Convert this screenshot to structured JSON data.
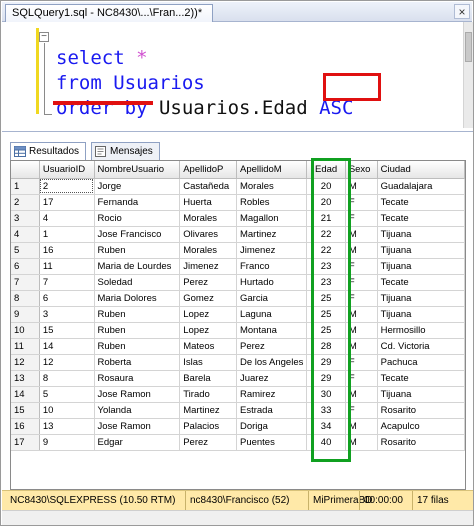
{
  "window": {
    "tab_title": "SQLQuery1.sql - NC8430\\...\\Fran...2))*",
    "close_glyph": "×"
  },
  "editor": {
    "line1": {
      "keyword": "select",
      "rest": " *"
    },
    "line2": {
      "keyword": "from",
      "rest": " Usuarios"
    },
    "line3": {
      "keyword": "order by",
      "rest": " Usuarios.Edad ",
      "highlight": "ASC"
    },
    "annotation_colors": {
      "underline": "#e01010",
      "asc_box": "#e01010",
      "edad_box": "#10a020"
    }
  },
  "results_tabs": [
    {
      "label": "Resultados",
      "icon": "grid-icon"
    },
    {
      "label": "Mensajes",
      "icon": "message-icon"
    }
  ],
  "grid": {
    "columns": [
      "",
      "UsuarioID",
      "NombreUsuario",
      "ApellidoP",
      "ApellidoM",
      "Edad",
      "Sexo",
      "Ciudad"
    ],
    "rows": [
      [
        "1",
        "2",
        "Jorge",
        "Castañeda",
        "Morales",
        "20",
        "M",
        "Guadalajara"
      ],
      [
        "2",
        "17",
        "Fernanda",
        "Huerta",
        "Robles",
        "20",
        "F",
        "Tecate"
      ],
      [
        "3",
        "4",
        "Rocio",
        "Morales",
        "Magallon",
        "21",
        "F",
        "Tecate"
      ],
      [
        "4",
        "1",
        "Jose Francisco",
        "Olivares",
        "Martinez",
        "22",
        "M",
        "Tijuana"
      ],
      [
        "5",
        "16",
        "Ruben",
        "Morales",
        "Jimenez",
        "22",
        "M",
        "Tijuana"
      ],
      [
        "6",
        "11",
        "Maria de Lourdes",
        "Jimenez",
        "Franco",
        "23",
        "F",
        "Tijuana"
      ],
      [
        "7",
        "7",
        "Soledad",
        "Perez",
        "Hurtado",
        "23",
        "F",
        "Tecate"
      ],
      [
        "8",
        "6",
        "Maria Dolores",
        "Gomez",
        "Garcia",
        "25",
        "F",
        "Tijuana"
      ],
      [
        "9",
        "3",
        "Ruben",
        "Lopez",
        "Laguna",
        "25",
        "M",
        "Tijuana"
      ],
      [
        "10",
        "15",
        "Ruben",
        "Lopez",
        "Montana",
        "25",
        "M",
        "Hermosillo"
      ],
      [
        "11",
        "14",
        "Ruben",
        "Mateos",
        "Perez",
        "28",
        "M",
        "Cd. Victoria"
      ],
      [
        "12",
        "12",
        "Roberta",
        "Islas",
        "De los Angeles",
        "29",
        "F",
        "Pachuca"
      ],
      [
        "13",
        "8",
        "Rosaura",
        "Barela",
        "Juarez",
        "29",
        "F",
        "Tecate"
      ],
      [
        "14",
        "5",
        "Jose Ramon",
        "Tirado",
        "Ramirez",
        "30",
        "M",
        "Tijuana"
      ],
      [
        "15",
        "10",
        "Yolanda",
        "Martinez",
        "Estrada",
        "33",
        "F",
        "Rosarito"
      ],
      [
        "16",
        "13",
        "Jose Ramon",
        "Palacios",
        "Doriga",
        "34",
        "M",
        "Acapulco"
      ],
      [
        "17",
        "9",
        "Edgar",
        "Perez",
        "Puentes",
        "40",
        "M",
        "Rosarito"
      ]
    ]
  },
  "status": {
    "server": "NC8430\\SQLEXPRESS (10.50 RTM)",
    "user": "nc8430\\Francisco (52)",
    "database": "MiPrimeraBD",
    "elapsed": "00:00:00",
    "rows": "17 filas",
    "background": "#ffe9a8"
  }
}
